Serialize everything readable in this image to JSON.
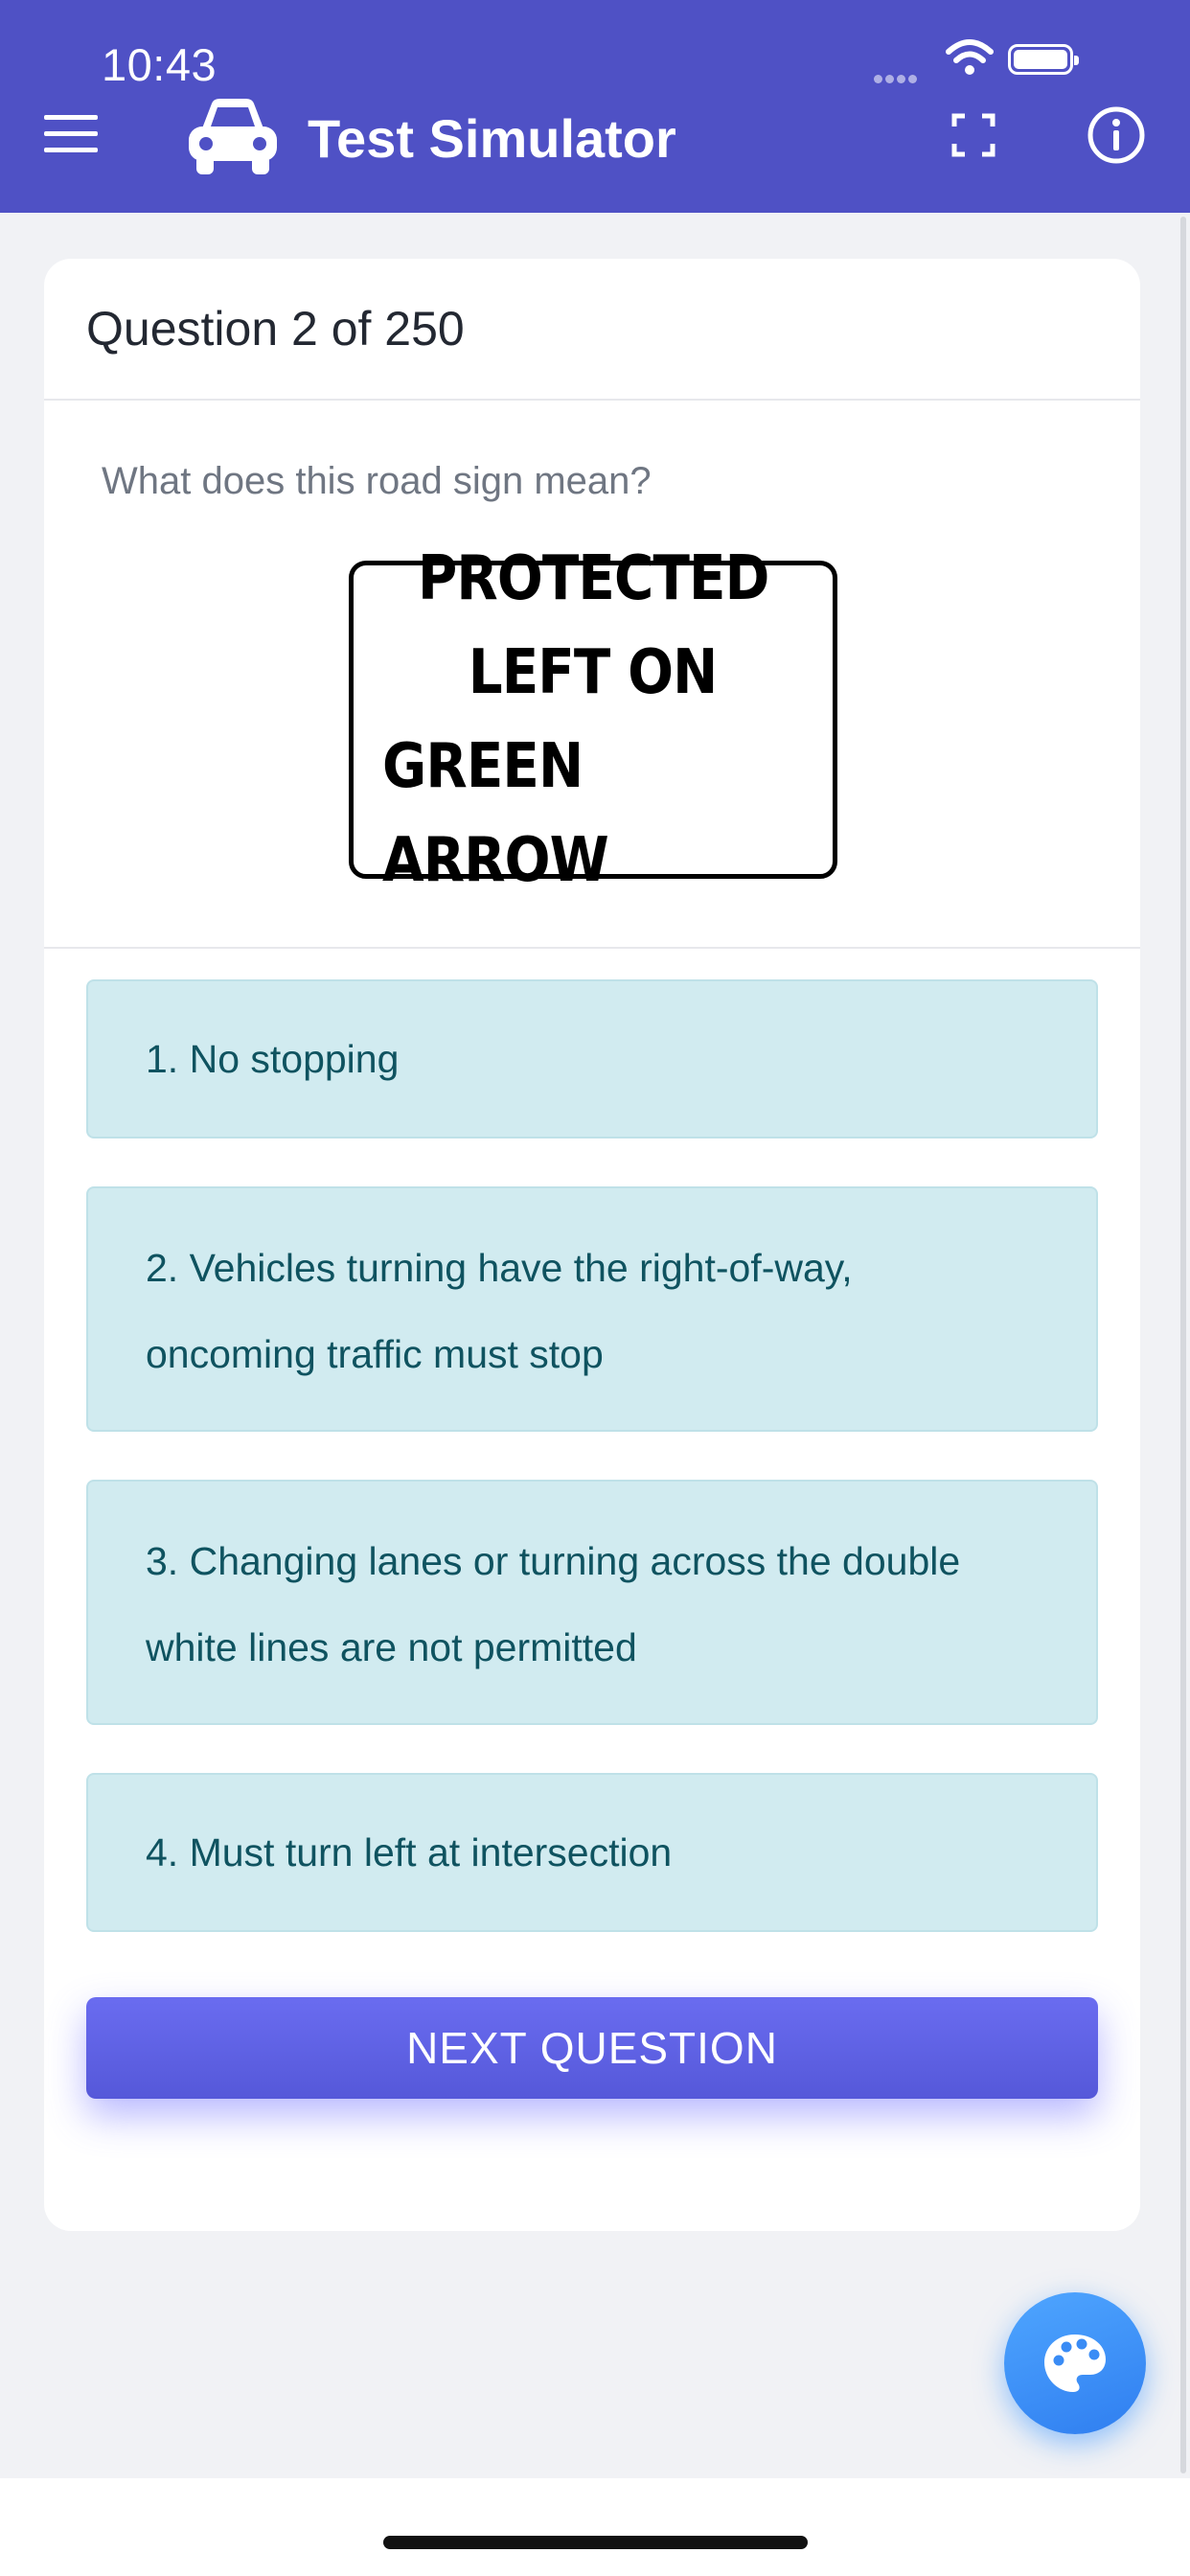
{
  "status_bar": {
    "time": "10:43",
    "icons": [
      "signal-dots-icon",
      "wifi-icon",
      "battery-icon"
    ]
  },
  "app_bar": {
    "title": "Test Simulator",
    "left_icons": [
      "menu-icon",
      "car-icon"
    ],
    "right_icons": [
      "fullscreen-icon",
      "info-icon"
    ],
    "background_color": "#4f51c5"
  },
  "question": {
    "counter": "Question 2 of 250",
    "text": "What does this road sign mean?",
    "sign_lines": [
      "PROTECTED",
      "LEFT ON",
      "GREEN ARROW"
    ]
  },
  "answers": [
    {
      "line1": "1. No stopping",
      "line2": ""
    },
    {
      "line1": "2. Vehicles turning have the right-of-way,",
      "line2": "oncoming traffic must stop"
    },
    {
      "line1": "3. Changing lanes or turning across the double",
      "line2": "white lines are not permitted"
    },
    {
      "line1": "4. Must turn left at intersection",
      "line2": ""
    }
  ],
  "next_button": {
    "label": "NEXT QUESTION",
    "color": "#5b5de3"
  },
  "fab": {
    "icon": "palette-icon",
    "color": "#3a8cf5"
  },
  "colors": {
    "answer_bg": "#d1ebf0",
    "answer_text": "#0f5360",
    "page_bg": "#f1f2f5"
  }
}
